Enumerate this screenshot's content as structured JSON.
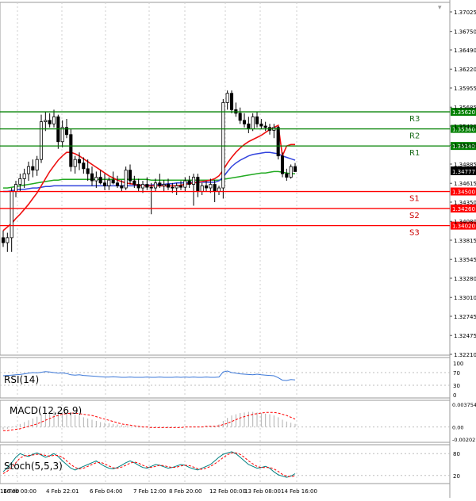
{
  "chart_data": [
    {
      "type": "candlestick",
      "panel": "price",
      "ylim": [
        1.32085,
        1.37085
      ],
      "y_ticks": [
        "1.37025",
        "1.36750",
        "1.36490",
        "1.36220",
        "1.35955",
        "1.35685",
        "1.35420",
        "1.35150",
        "1.34885",
        "1.34615",
        "1.34350",
        "1.34080",
        "1.33815",
        "1.33545",
        "1.33280",
        "1.33010",
        "1.32745",
        "1.32475",
        "1.32210"
      ],
      "x_ticks": [
        "16:00",
        "4 Feb 22:01",
        "6 Feb 04:00",
        "7 Feb 12:00",
        "8 Feb 20:00",
        "12 Feb 00:00",
        "13 Feb 08:00",
        "14 Feb 16:00",
        "16 Feb 00:00"
      ],
      "last_price": "1.34777",
      "levels": [
        {
          "name": "R3",
          "value": 1.3562,
          "label": "1.35620",
          "color": "#008000"
        },
        {
          "name": "R2",
          "value": 1.3538,
          "label": "1.35380",
          "color": "#008000"
        },
        {
          "name": "R1",
          "value": 1.3514,
          "label": "1.35140",
          "color": "#008000"
        },
        {
          "name": "S1",
          "value": 1.345,
          "label": "1.34500",
          "color": "#ff0000"
        },
        {
          "name": "S2",
          "value": 1.3426,
          "label": "1.34260",
          "color": "#ff0000"
        },
        {
          "name": "S3",
          "value": 1.3402,
          "label": "1.34020",
          "color": "#ff0000"
        }
      ],
      "candles": [
        [
          1.3385,
          1.3395,
          1.3372,
          1.3378
        ],
        [
          1.3378,
          1.3392,
          1.3365,
          1.3385
        ],
        [
          1.3385,
          1.3455,
          1.3365,
          1.345
        ],
        [
          1.345,
          1.3465,
          1.3442,
          1.346
        ],
        [
          1.346,
          1.3475,
          1.345,
          1.3468
        ],
        [
          1.3468,
          1.3482,
          1.3455,
          1.3475
        ],
        [
          1.3475,
          1.3492,
          1.3465,
          1.3485
        ],
        [
          1.3485,
          1.3495,
          1.347,
          1.348
        ],
        [
          1.348,
          1.35,
          1.3472,
          1.3495
        ],
        [
          1.3495,
          1.3558,
          1.349,
          1.3548
        ],
        [
          1.3548,
          1.3562,
          1.3535,
          1.355
        ],
        [
          1.355,
          1.356,
          1.354,
          1.3545
        ],
        [
          1.3545,
          1.3565,
          1.354,
          1.3555
        ],
        [
          1.3555,
          1.3558,
          1.351,
          1.352
        ],
        [
          1.352,
          1.355,
          1.3512,
          1.354
        ],
        [
          1.354,
          1.3552,
          1.3525,
          1.353
        ],
        [
          1.353,
          1.3538,
          1.3478,
          1.3485
        ],
        [
          1.3485,
          1.35,
          1.3475,
          1.3495
        ],
        [
          1.3495,
          1.3505,
          1.348,
          1.349
        ],
        [
          1.349,
          1.3498,
          1.3475,
          1.3482
        ],
        [
          1.3482,
          1.3495,
          1.3465,
          1.3475
        ],
        [
          1.3475,
          1.3485,
          1.3458,
          1.3465
        ],
        [
          1.3465,
          1.3478,
          1.3455,
          1.347
        ],
        [
          1.347,
          1.348,
          1.346,
          1.3462
        ],
        [
          1.3462,
          1.3475,
          1.3452,
          1.3458
        ],
        [
          1.3458,
          1.347,
          1.3452,
          1.3466
        ],
        [
          1.3466,
          1.3478,
          1.346,
          1.3462
        ],
        [
          1.3462,
          1.3472,
          1.3455,
          1.3458
        ],
        [
          1.3458,
          1.3466,
          1.345,
          1.3455
        ],
        [
          1.3455,
          1.3485,
          1.3452,
          1.348
        ],
        [
          1.348,
          1.3488,
          1.346,
          1.3465
        ],
        [
          1.3465,
          1.3472,
          1.3455,
          1.346
        ],
        [
          1.346,
          1.3468,
          1.345,
          1.3455
        ],
        [
          1.3455,
          1.3465,
          1.3448,
          1.346
        ],
        [
          1.346,
          1.347,
          1.3452,
          1.3456
        ],
        [
          1.3456,
          1.3462,
          1.3418,
          1.3455
        ],
        [
          1.3455,
          1.3468,
          1.345,
          1.3462
        ],
        [
          1.3462,
          1.3475,
          1.3455,
          1.3458
        ],
        [
          1.3458,
          1.3466,
          1.345,
          1.346
        ],
        [
          1.346,
          1.3468,
          1.3452,
          1.3456
        ],
        [
          1.3456,
          1.3462,
          1.3448,
          1.3455
        ],
        [
          1.3455,
          1.3462,
          1.3445,
          1.3458
        ],
        [
          1.3458,
          1.3465,
          1.3452,
          1.3456
        ],
        [
          1.3456,
          1.347,
          1.345,
          1.3465
        ],
        [
          1.3465,
          1.3472,
          1.3455,
          1.346
        ],
        [
          1.346,
          1.3475,
          1.343,
          1.347
        ],
        [
          1.347,
          1.3475,
          1.3442,
          1.345
        ],
        [
          1.345,
          1.3462,
          1.3445,
          1.3458
        ],
        [
          1.3458,
          1.3465,
          1.345,
          1.3455
        ],
        [
          1.3455,
          1.3468,
          1.3448,
          1.346
        ],
        [
          1.346,
          1.3466,
          1.3435,
          1.345
        ],
        [
          1.345,
          1.3458,
          1.3445,
          1.3455
        ],
        [
          1.3455,
          1.358,
          1.344,
          1.3575
        ],
        [
          1.3575,
          1.3592,
          1.3565,
          1.3588
        ],
        [
          1.3588,
          1.3592,
          1.356,
          1.3565
        ],
        [
          1.3565,
          1.3575,
          1.3555,
          1.356
        ],
        [
          1.356,
          1.3568,
          1.3545,
          1.355
        ],
        [
          1.355,
          1.356,
          1.354,
          1.3545
        ],
        [
          1.3545,
          1.3555,
          1.3532,
          1.3538
        ],
        [
          1.3538,
          1.356,
          1.3535,
          1.3555
        ],
        [
          1.3555,
          1.3562,
          1.354,
          1.3545
        ],
        [
          1.3545,
          1.3552,
          1.3538,
          1.3542
        ],
        [
          1.3542,
          1.3548,
          1.3535,
          1.354
        ],
        [
          1.354,
          1.3545,
          1.353,
          1.3536
        ],
        [
          1.3536,
          1.3545,
          1.3525,
          1.354
        ],
        [
          1.354,
          1.3542,
          1.3495,
          1.35
        ],
        [
          1.35,
          1.3505,
          1.347,
          1.3475
        ],
        [
          1.3475,
          1.3482,
          1.3465,
          1.347
        ],
        [
          1.347,
          1.3488,
          1.3468,
          1.3485
        ],
        [
          1.3485,
          1.349,
          1.3478,
          1.3478
        ]
      ],
      "ma_red": [
        1.3395,
        1.34,
        1.3405,
        1.3412,
        1.3418,
        1.3425,
        1.3432,
        1.344,
        1.3448,
        1.3458,
        1.3468,
        1.3478,
        1.3486,
        1.3494,
        1.35,
        1.3505,
        1.3505,
        1.3503,
        1.35,
        1.3496,
        1.3492,
        1.3488,
        1.3484,
        1.348,
        1.3476,
        1.3472,
        1.3469,
        1.3466,
        1.3464,
        1.3462,
        1.3461,
        1.346,
        1.3459,
        1.3458,
        1.3458,
        1.3458,
        1.3458,
        1.3458,
        1.3458,
        1.3458,
        1.3458,
        1.3458,
        1.3459,
        1.346,
        1.3461,
        1.3462,
        1.3463,
        1.3464,
        1.3465,
        1.3466,
        1.3468,
        1.3472,
        1.348,
        1.349,
        1.3498,
        1.3505,
        1.3511,
        1.3516,
        1.352,
        1.3523,
        1.3526,
        1.3529,
        1.3533,
        1.3537,
        1.354,
        1.3543,
        1.35,
        1.3514,
        1.3516,
        1.3516
      ],
      "ma_blue": [
        1.345,
        1.345,
        1.3451,
        1.3452,
        1.3453,
        1.3453,
        1.3454,
        1.3455,
        1.3455,
        1.3456,
        1.3457,
        1.3457,
        1.3458,
        1.3458,
        1.3458,
        1.3458,
        1.3458,
        1.3458,
        1.3458,
        1.3458,
        1.3458,
        1.3458,
        1.3458,
        1.3458,
        1.3458,
        1.3458,
        1.3458,
        1.3458,
        1.3458,
        1.3458,
        1.3458,
        1.3458,
        1.3459,
        1.3459,
        1.3459,
        1.3459,
        1.346,
        1.346,
        1.346,
        1.3461,
        1.3461,
        1.3462,
        1.3462,
        1.3462,
        1.3462,
        1.3463,
        1.3463,
        1.3463,
        1.3463,
        1.3463,
        1.3463,
        1.3465,
        1.347,
        1.3478,
        1.3485,
        1.349,
        1.3494,
        1.3497,
        1.35,
        1.3502,
        1.3503,
        1.3504,
        1.3505,
        1.3505,
        1.3504,
        1.3503,
        1.35,
        1.3498,
        1.3496,
        1.3494
      ],
      "ma_green": [
        1.3455,
        1.3455,
        1.3456,
        1.3457,
        1.3458,
        1.3459,
        1.346,
        1.3461,
        1.3462,
        1.3463,
        1.3464,
        1.3465,
        1.3466,
        1.3466,
        1.3467,
        1.3467,
        1.3467,
        1.3467,
        1.3467,
        1.3467,
        1.3467,
        1.3467,
        1.3467,
        1.3467,
        1.3467,
        1.3467,
        1.3467,
        1.3467,
        1.3467,
        1.3467,
        1.3467,
        1.3467,
        1.3467,
        1.3467,
        1.3467,
        1.3466,
        1.3466,
        1.3466,
        1.3466,
        1.3466,
        1.3466,
        1.3466,
        1.3466,
        1.3466,
        1.3466,
        1.3466,
        1.3466,
        1.3466,
        1.3466,
        1.3466,
        1.3466,
        1.3466,
        1.3467,
        1.3468,
        1.3469,
        1.347,
        1.3471,
        1.3472,
        1.3473,
        1.3474,
        1.3475,
        1.3476,
        1.3476,
        1.3477,
        1.3478,
        1.3478,
        1.3477,
        1.3476,
        1.3475,
        1.3475
      ]
    },
    {
      "type": "line",
      "panel": "rsi",
      "title": "RSI(14)",
      "ylim": [
        0,
        100
      ],
      "y_ticks": [
        "100",
        "70",
        "30",
        "0"
      ],
      "values": [
        60,
        61,
        62,
        63,
        64,
        66,
        68,
        70,
        69,
        71,
        73,
        72,
        70,
        68,
        69,
        67,
        63,
        62,
        63,
        61,
        60,
        59,
        58,
        57,
        56,
        56,
        57,
        56,
        55,
        55,
        56,
        55,
        55,
        55,
        56,
        55,
        55,
        56,
        55,
        55,
        55,
        56,
        55,
        56,
        55,
        56,
        55,
        55,
        56,
        55,
        55,
        56,
        72,
        75,
        70,
        68,
        66,
        65,
        64,
        63,
        65,
        63,
        62,
        61,
        60,
        54,
        46,
        45,
        48,
        47
      ]
    },
    {
      "type": "bar_line",
      "panel": "macd",
      "title": "MACD(12,26,9)",
      "ylim": [
        -0.002021,
        0.003754
      ],
      "y_ticks": [
        "0.003754",
        "0.00",
        "-0.002021"
      ],
      "histogram": [
        -0.0004,
        -0.0003,
        -0.0001,
        0.0002,
        0.0005,
        0.0008,
        0.0011,
        0.0014,
        0.0017,
        0.002,
        0.0023,
        0.0025,
        0.0026,
        0.0026,
        0.0025,
        0.0024,
        0.0022,
        0.002,
        0.0018,
        0.0016,
        0.0014,
        0.0012,
        0.001,
        0.0008,
        0.0007,
        0.0006,
        0.0005,
        0.0004,
        0.0003,
        0.0002,
        0.0001,
        0.0,
        -0.0001,
        -0.0001,
        -0.0001,
        -0.0001,
        -0.0001,
        -0.0001,
        -0.0001,
        -0.0001,
        0.0,
        0.0,
        0.0,
        0.0,
        0.0,
        0.0,
        0.0,
        0.0,
        0.0001,
        0.0001,
        0.0002,
        0.0004,
        0.001,
        0.0015,
        0.0019,
        0.0021,
        0.0023,
        0.0024,
        0.0025,
        0.0025,
        0.0024,
        0.0023,
        0.0022,
        0.0021,
        0.0019,
        0.0016,
        0.0012,
        0.0009,
        0.0007,
        0.0005
      ],
      "signal": [
        -0.0006,
        -0.0006,
        -0.0005,
        -0.0004,
        -0.0003,
        -0.0001,
        0.0001,
        0.0003,
        0.0005,
        0.0008,
        0.0011,
        0.0014,
        0.0017,
        0.0019,
        0.0021,
        0.0022,
        0.0023,
        0.0023,
        0.0022,
        0.0021,
        0.002,
        0.0019,
        0.0017,
        0.0015,
        0.0013,
        0.0011,
        0.0009,
        0.0007,
        0.0005,
        0.0004,
        0.0003,
        0.0002,
        0.0001,
        0.0,
        0.0,
        -0.0001,
        -0.0001,
        -0.0001,
        -0.0001,
        -0.0001,
        -0.0001,
        -0.0001,
        -0.0001,
        0.0,
        0.0,
        0.0,
        0.0,
        0.0,
        0.0001,
        0.0001,
        0.0001,
        0.0002,
        0.0004,
        0.0006,
        0.0009,
        0.0012,
        0.0015,
        0.0017,
        0.0019,
        0.0021,
        0.0022,
        0.0023,
        0.0024,
        0.0024,
        0.0024,
        0.0023,
        0.0021,
        0.0019,
        0.0016,
        0.0013
      ]
    },
    {
      "type": "line",
      "panel": "stoch",
      "title": "Stoch(5,5,3)",
      "ylim": [
        0,
        100
      ],
      "y_ticks": [
        "80",
        "20"
      ],
      "series": [
        {
          "color": "#008080",
          "values": [
            30,
            42,
            55,
            70,
            80,
            75,
            72,
            78,
            82,
            76,
            70,
            74,
            80,
            72,
            60,
            50,
            40,
            35,
            40,
            45,
            50,
            55,
            60,
            52,
            45,
            40,
            38,
            42,
            48,
            55,
            60,
            55,
            48,
            42,
            40,
            45,
            50,
            48,
            44,
            40,
            42,
            46,
            50,
            48,
            42,
            38,
            35,
            40,
            45,
            50,
            60,
            70,
            78,
            82,
            85,
            80,
            70,
            60,
            50,
            45,
            40,
            42,
            45,
            40,
            30,
            22,
            18,
            15,
            18,
            25
          ]
        },
        {
          "color": "#ff0000",
          "values": [
            25,
            32,
            42,
            55,
            68,
            74,
            75,
            76,
            78,
            78,
            75,
            73,
            75,
            75,
            70,
            60,
            50,
            42,
            38,
            40,
            45,
            50,
            55,
            56,
            52,
            46,
            41,
            40,
            43,
            48,
            54,
            57,
            54,
            48,
            43,
            42,
            45,
            48,
            47,
            44,
            42,
            43,
            46,
            48,
            47,
            43,
            38,
            37,
            40,
            45,
            52,
            60,
            69,
            77,
            82,
            82,
            78,
            70,
            60,
            52,
            45,
            42,
            42,
            42,
            38,
            31,
            23,
            18,
            17,
            19
          ]
        }
      ]
    }
  ]
}
